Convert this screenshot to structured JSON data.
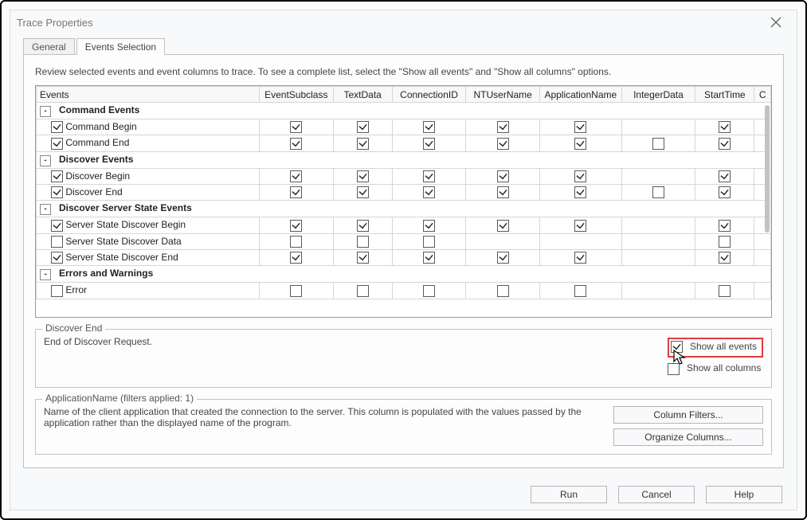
{
  "window": {
    "title": "Trace Properties"
  },
  "tabs": {
    "general": "General",
    "eventsSel": "Events Selection"
  },
  "intro": "Review selected events and event columns to trace. To see a complete list, select the \"Show all events\" and \"Show all columns\" options.",
  "columns": [
    "Events",
    "EventSubclass",
    "TextData",
    "ConnectionID",
    "NTUserName",
    "ApplicationName",
    "IntegerData",
    "StartTime",
    "C"
  ],
  "rows": [
    {
      "type": "category",
      "label": "Command Events",
      "expander": "-"
    },
    {
      "type": "event",
      "label": "Command Begin",
      "rowcheck": true,
      "cells": [
        true,
        true,
        true,
        true,
        true,
        null,
        true,
        null
      ]
    },
    {
      "type": "event",
      "label": "Command End",
      "rowcheck": true,
      "cells": [
        true,
        true,
        true,
        true,
        true,
        false,
        true,
        null
      ]
    },
    {
      "type": "category",
      "label": "Discover Events",
      "expander": "-"
    },
    {
      "type": "event",
      "label": "Discover Begin",
      "rowcheck": true,
      "cells": [
        true,
        true,
        true,
        true,
        true,
        null,
        true,
        null
      ]
    },
    {
      "type": "event",
      "label": "Discover End",
      "rowcheck": true,
      "cells": [
        true,
        true,
        true,
        true,
        true,
        false,
        true,
        null
      ]
    },
    {
      "type": "category",
      "label": "Discover Server State Events",
      "expander": "-"
    },
    {
      "type": "event",
      "label": "Server State Discover Begin",
      "rowcheck": true,
      "cells": [
        true,
        true,
        true,
        true,
        true,
        null,
        true,
        null
      ]
    },
    {
      "type": "event",
      "label": "Server State Discover Data",
      "rowcheck": false,
      "cells": [
        false,
        false,
        false,
        null,
        null,
        null,
        false,
        null
      ]
    },
    {
      "type": "event",
      "label": "Server State Discover End",
      "rowcheck": true,
      "cells": [
        true,
        true,
        true,
        true,
        true,
        null,
        true,
        null
      ]
    },
    {
      "type": "category",
      "label": "Errors and Warnings",
      "expander": "-"
    },
    {
      "type": "eventPartial",
      "label": "Error",
      "rowcheck": false,
      "cells": [
        false,
        false,
        false,
        false,
        false,
        null,
        false,
        null
      ]
    }
  ],
  "detail": {
    "title": "Discover End",
    "desc": "End of Discover Request.",
    "showAllEvents": {
      "label": "Show all events",
      "checked": true
    },
    "showAllColumns": {
      "label": "Show all columns",
      "checked": false
    }
  },
  "appname": {
    "title": "ApplicationName (filters applied: 1)",
    "desc": "Name of the client application that created the connection to the server. This column is populated with the values passed by the application rather than the displayed name of the program.",
    "btnFilters": "Column Filters...",
    "btnOrganize": "Organize Columns..."
  },
  "buttons": {
    "run": "Run",
    "cancel": "Cancel",
    "help": "Help"
  }
}
